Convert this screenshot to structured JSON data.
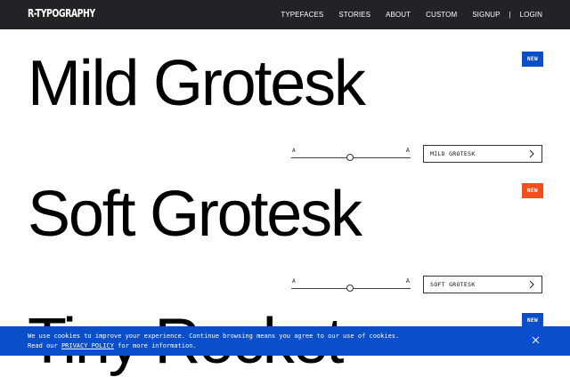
{
  "header": {
    "logo": "R-TYPOGRAPHY",
    "nav": [
      "TYPEFACES",
      "STORIES",
      "ABOUT",
      "CUSTOM",
      "SIGNUP"
    ],
    "separator": "|",
    "login": "LOGIN"
  },
  "specimens": [
    {
      "title": "Mild Grotesk",
      "badge": "NEW",
      "badge_color": "#0a4fc9",
      "button_label": "MILD GROTESK",
      "size_slider": {
        "small_label": "A",
        "large_label": "A",
        "value": 0.49
      }
    },
    {
      "title": "Soft Grotesk",
      "badge": "NEW",
      "badge_color": "#f0501e",
      "button_label": "SOFT GROTESK",
      "size_slider": {
        "small_label": "A",
        "large_label": "A",
        "value": 0.49
      }
    },
    {
      "title": "Tiny Rocket",
      "badge": "NEW",
      "badge_color": "#0a4fc9"
    }
  ],
  "cookie_banner": {
    "line1": "We use cookies to improve your experience. Continue browsing means you agree to our use of cookies.",
    "line2_prefix": "Read our ",
    "policy_link": "PRIVACY POLICY",
    "line2_suffix": " for more information.",
    "close_icon": "close-icon",
    "background": "#0a4fc9"
  },
  "icons": {
    "arrow": "chevron-right-icon",
    "close": "close-icon"
  }
}
